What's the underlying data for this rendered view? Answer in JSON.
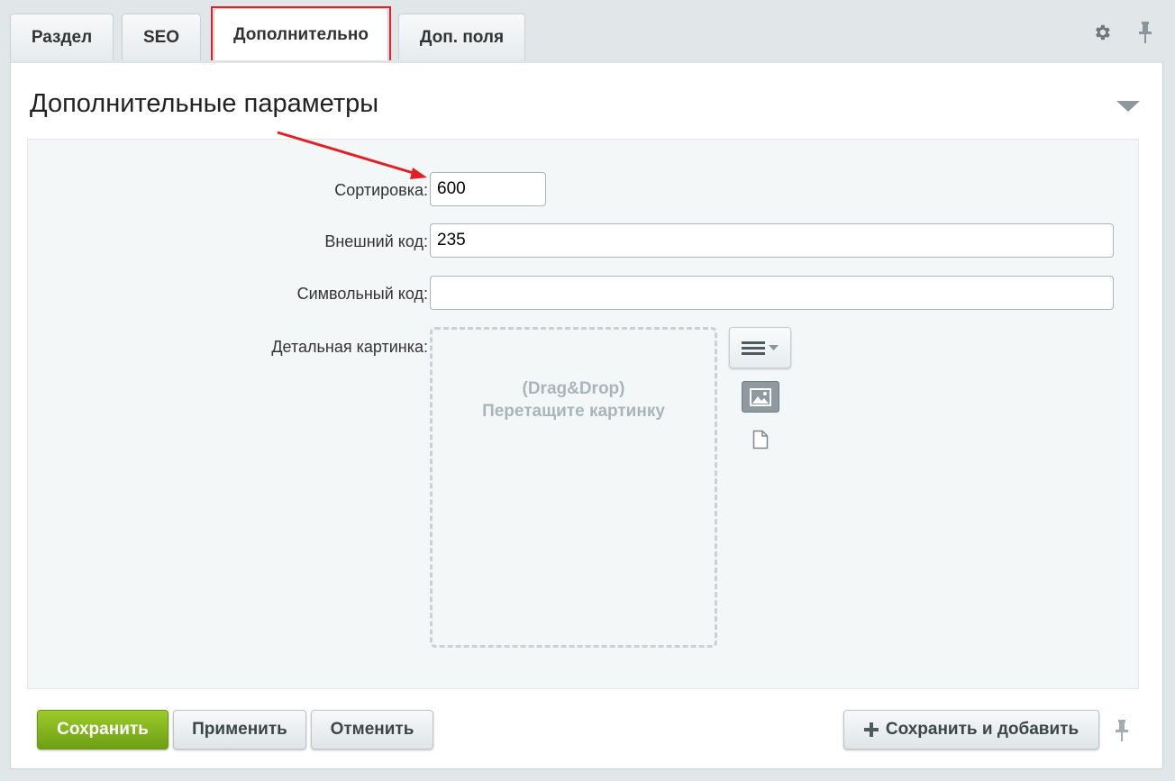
{
  "tabs": [
    {
      "label": "Раздел"
    },
    {
      "label": "SEO"
    },
    {
      "label": "Дополнительно"
    },
    {
      "label": "Доп. поля"
    }
  ],
  "section": {
    "title": "Дополнительные параметры"
  },
  "form": {
    "sort": {
      "label": "Сортировка:",
      "value": "600"
    },
    "external_code": {
      "label": "Внешний код:",
      "value": "235"
    },
    "symbol_code": {
      "label": "Символьный код:",
      "value": ""
    },
    "detail_picture": {
      "label": "Детальная картинка:",
      "dropzone_line1": "(Drag&Drop)",
      "dropzone_line2": "Перетащите картинку"
    }
  },
  "buttons": {
    "save": "Сохранить",
    "apply": "Применить",
    "cancel": "Отменить",
    "save_and_add": "Сохранить и добавить"
  },
  "colors": {
    "highlight": "#e31e24",
    "save_green": "#86b51f"
  },
  "icons": [
    "gear-icon",
    "pin-icon",
    "collapse-arrow-icon",
    "menu-icon",
    "image-icon",
    "file-icon",
    "plus-icon"
  ]
}
